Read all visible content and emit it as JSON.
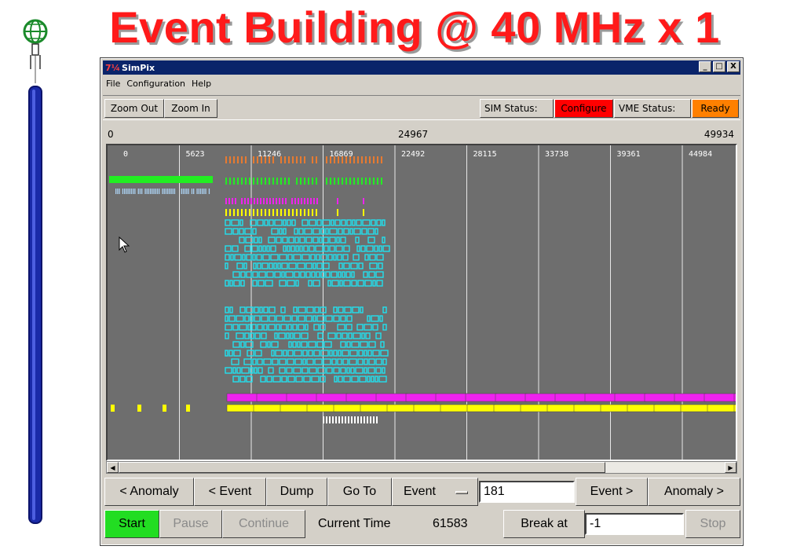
{
  "slide": {
    "title": "Event Building @ 40 MHz x 1"
  },
  "window": {
    "app_icon": "7¼",
    "title": "SimPix",
    "controls": {
      "minimize": "_",
      "maximize": "□",
      "close": "X"
    }
  },
  "menu": {
    "items": [
      "File",
      "Configuration",
      "Help"
    ]
  },
  "toolbar": {
    "zoom_out": "Zoom Out",
    "zoom_in": "Zoom In",
    "sim_status_label": "SIM Status:",
    "sim_status_value": "Configure",
    "sim_status_color": "#ff0000",
    "vme_status_label": "VME Status:",
    "vme_status_value": "Ready",
    "vme_status_color": "#ff8000"
  },
  "ruler": {
    "left": "0",
    "middle": "24967",
    "right": "49934"
  },
  "timeline": {
    "ticks": [
      "0",
      "5623",
      "11246",
      "16869",
      "22492",
      "28115",
      "33738",
      "39361",
      "44984"
    ],
    "colors": {
      "background": "#6e6e6e",
      "orange": "#e87a30",
      "green": "#22ee22",
      "lightblue": "#aad0f0",
      "magenta": "#ee22ee",
      "yellow": "#ffff00",
      "cyan": "#22e0ee",
      "white": "#ffffff"
    }
  },
  "nav": {
    "prev_anomaly": "< Anomaly",
    "prev_event": "< Event",
    "dump": "Dump",
    "goto": "Go To",
    "event_select": "Event",
    "event_value": "181",
    "next_event": "Event >",
    "next_anomaly": "Anomaly >"
  },
  "controls": {
    "start": "Start",
    "start_color": "#22dd22",
    "pause": "Pause",
    "continue": "Continue",
    "current_time_label": "Current Time",
    "current_time_value": "61583",
    "break_at_label": "Break at",
    "break_at_value": "-1",
    "stop": "Stop"
  }
}
